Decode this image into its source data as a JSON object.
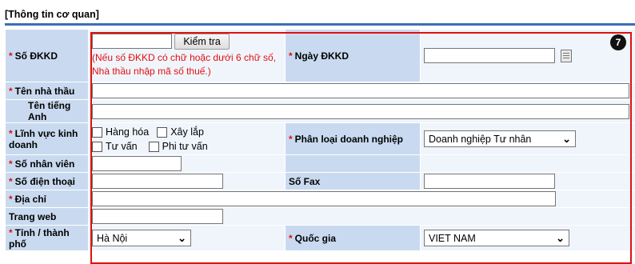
{
  "section": {
    "title": "[Thông tin cơ quan]"
  },
  "step_badge": "7",
  "fields": {
    "so_dkkd": {
      "label": "Số ĐKKD",
      "value": "",
      "check_button": "Kiểm tra",
      "note": "(Nếu số ĐKKD có chữ hoặc dưới 6 chữ số, Nhà thầu nhập mã số thuế.)"
    },
    "ngay_dkkd": {
      "label": "Ngày ĐKKD",
      "value": ""
    },
    "ten_nha_thau": {
      "label": "Tên nhà thầu",
      "value": ""
    },
    "ten_tieng_anh": {
      "label": "Tên tiếng Anh",
      "value": ""
    },
    "linh_vuc": {
      "label": "Lĩnh vực kinh doanh",
      "options": [
        "Hàng hóa",
        "Xây lắp",
        "Tư vấn",
        "Phi tư vấn"
      ],
      "checked": [
        false,
        false,
        false,
        false
      ]
    },
    "phan_loai": {
      "label": "Phân loại doanh nghiệp",
      "selected": "Doanh nghiệp Tư nhân"
    },
    "so_nhan_vien": {
      "label": "Số nhân viên",
      "value": ""
    },
    "so_dien_thoai": {
      "label": "Số điện thoại",
      "value": ""
    },
    "so_fax": {
      "label": "Số Fax",
      "value": ""
    },
    "dia_chi": {
      "label": "Địa chỉ",
      "value": ""
    },
    "trang_web": {
      "label": "Trang web",
      "value": ""
    },
    "tinh_thanh_pho": {
      "label": "Tỉnh / thành phố",
      "selected": "Hà Nội"
    },
    "quoc_gia": {
      "label": "Quốc gia",
      "selected": "VIET NAM"
    }
  },
  "required_marker": "*",
  "icons": {
    "calendar": "calendar-icon",
    "dropdown": "chevron-down-icon"
  },
  "colors": {
    "label_bg": "#c9daf0",
    "value_bg": "#f0f5fc",
    "required": "#e01010",
    "highlight_border": "#e01010",
    "rule": "#3b6fb6"
  }
}
